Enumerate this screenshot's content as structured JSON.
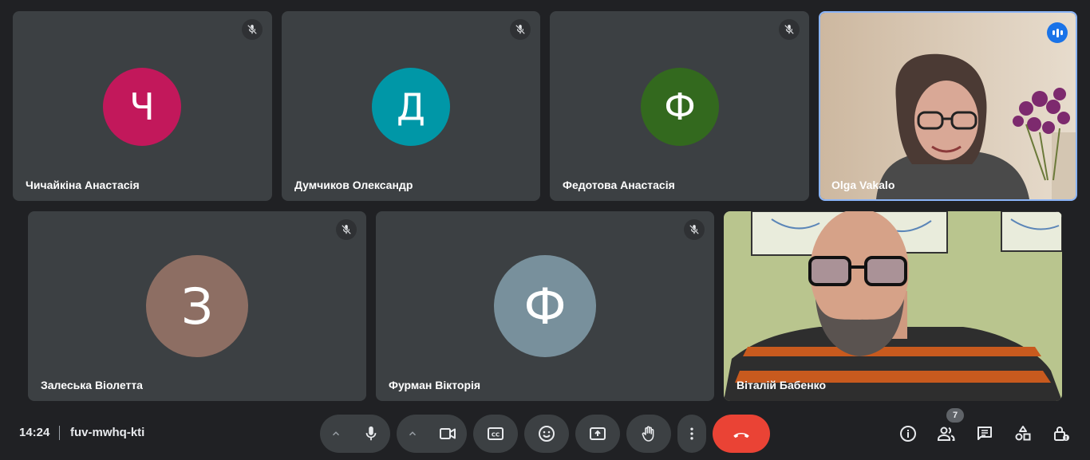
{
  "participants": [
    {
      "name": "Чичайкіна Анастасія",
      "initial": "Ч",
      "avatar_color": "#c2185b",
      "muted": true
    },
    {
      "name": "Думчиков Олександр",
      "initial": "Д",
      "avatar_color": "#0097a7",
      "muted": true
    },
    {
      "name": "Федотова Анастасія",
      "initial": "Ф",
      "avatar_color": "#33691e",
      "muted": true
    },
    {
      "name": "Olga Vakalo",
      "video": true,
      "speaking": true
    },
    {
      "name": "Залеська Віолетта",
      "initial": "З",
      "avatar_color": "#8d6e63",
      "muted": true
    },
    {
      "name": "Фурман Вікторія",
      "initial": "Ф",
      "avatar_color": "#78909c",
      "muted": true
    },
    {
      "name": "Віталій Бабенко",
      "video": true
    }
  ],
  "meeting": {
    "time": "14:24",
    "code": "fuv-mwhq-kti",
    "participant_count": "7"
  },
  "icons": {
    "mic": "microphone-icon",
    "camera": "camera-icon",
    "captions": "closed-captions-icon",
    "emoji": "emoji-icon",
    "present": "present-screen-icon",
    "hand": "raise-hand-icon",
    "more": "more-vertical-icon",
    "hangup": "hang-up-icon",
    "info": "info-icon",
    "people": "people-icon",
    "chat": "chat-icon",
    "activities": "activities-icon",
    "host": "host-controls-icon"
  },
  "colors": {
    "background": "#202124",
    "tile": "#3c4043",
    "hangup": "#ea4335",
    "active_speaker": "#1a73e8"
  }
}
